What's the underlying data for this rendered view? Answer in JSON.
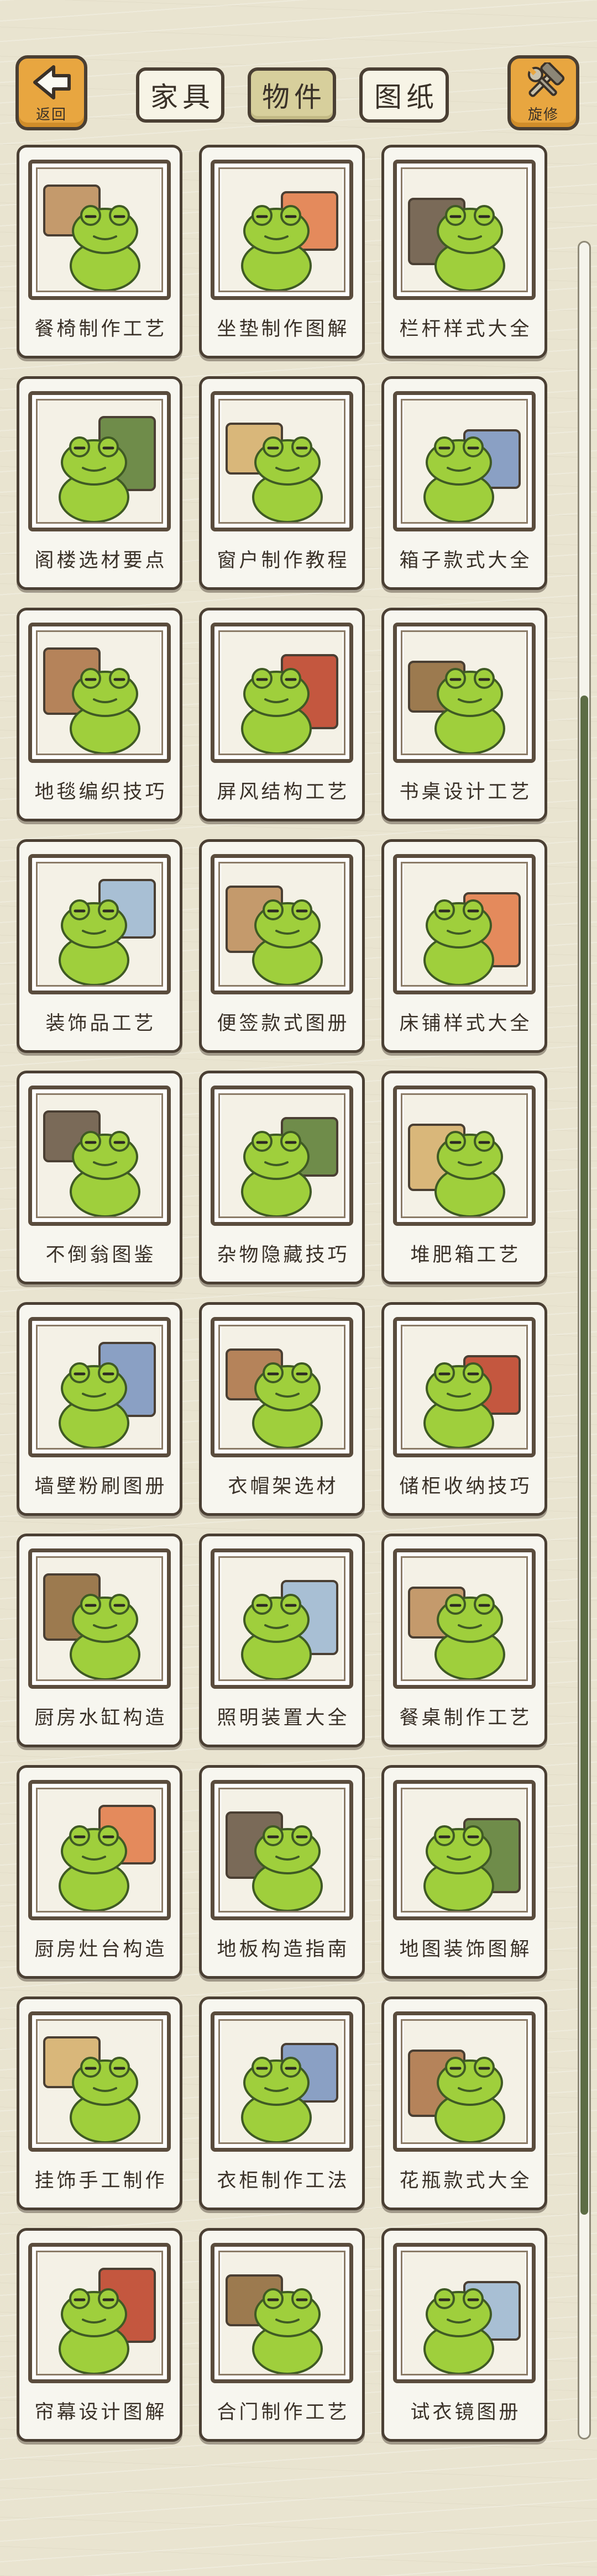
{
  "header": {
    "back_button": {
      "label": "返回",
      "icon": "back-arrow-icon"
    },
    "tool_button": {
      "label": "旋修",
      "icon": "wrench-hammer-icon"
    },
    "tabs": [
      {
        "label": "家具",
        "active": false
      },
      {
        "label": "物件",
        "active": true
      },
      {
        "label": "图纸",
        "active": false
      }
    ]
  },
  "colors": {
    "background": "#e9e4d0",
    "accent_button": "#e8a640",
    "active_tab": "#d7cf9c",
    "frog_green": "#9fcf3c",
    "outline": "#4a3f33",
    "scroll_thumb": "#5d6d45"
  },
  "items": [
    {
      "title": "餐椅制作工艺",
      "icon": "frog-chair-icon"
    },
    {
      "title": "坐垫制作图解",
      "icon": "frog-cushion-icon"
    },
    {
      "title": "栏杆样式大全",
      "icon": "frog-railing-icon"
    },
    {
      "title": "阁楼选材要点",
      "icon": "frog-loft-icon"
    },
    {
      "title": "窗户制作教程",
      "icon": "frog-window-icon"
    },
    {
      "title": "箱子款式大全",
      "icon": "frog-box-icon"
    },
    {
      "title": "地毯编织技巧",
      "icon": "frog-carpet-icon"
    },
    {
      "title": "屏风结构工艺",
      "icon": "frog-screen-icon"
    },
    {
      "title": "书桌设计工艺",
      "icon": "frog-desk-icon"
    },
    {
      "title": "装饰品工艺",
      "icon": "frog-ornament-icon"
    },
    {
      "title": "便签款式图册",
      "icon": "frog-note-icon"
    },
    {
      "title": "床铺样式大全",
      "icon": "frog-bed-icon"
    },
    {
      "title": "不倒翁图鉴",
      "icon": "frog-tumbler-icon"
    },
    {
      "title": "杂物隐藏技巧",
      "icon": "frog-hide-icon"
    },
    {
      "title": "堆肥箱工艺",
      "icon": "frog-compost-icon"
    },
    {
      "title": "墙壁粉刷图册",
      "icon": "frog-paint-icon"
    },
    {
      "title": "衣帽架选材",
      "icon": "frog-coat-rack-icon"
    },
    {
      "title": "储柜收纳技巧",
      "icon": "frog-storage-icon"
    },
    {
      "title": "厨房水缸构造",
      "icon": "frog-water-jar-icon"
    },
    {
      "title": "照明装置大全",
      "icon": "frog-lamp-icon"
    },
    {
      "title": "餐桌制作工艺",
      "icon": "frog-table-icon"
    },
    {
      "title": "厨房灶台构造",
      "icon": "frog-stove-icon"
    },
    {
      "title": "地板构造指南",
      "icon": "frog-floor-icon"
    },
    {
      "title": "地图装饰图解",
      "icon": "frog-map-icon"
    },
    {
      "title": "挂饰手工制作",
      "icon": "frog-hanging-icon"
    },
    {
      "title": "衣柜制作工法",
      "icon": "frog-wardrobe-icon"
    },
    {
      "title": "花瓶款式大全",
      "icon": "frog-vase-icon"
    },
    {
      "title": "帘幕设计图解",
      "icon": "frog-curtain-icon"
    },
    {
      "title": "合门制作工艺",
      "icon": "frog-door-icon"
    },
    {
      "title": "试衣镜图册",
      "icon": "frog-mirror-icon"
    }
  ]
}
